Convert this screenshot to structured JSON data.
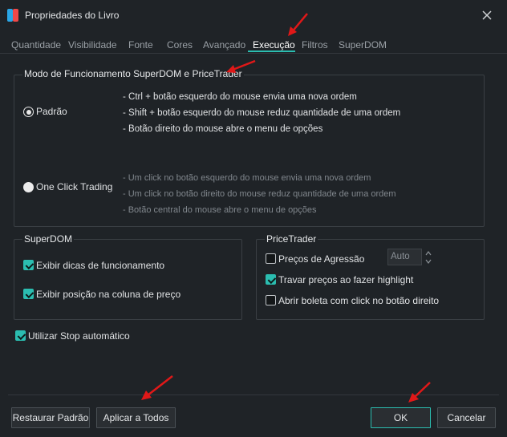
{
  "window": {
    "title": "Propriedades do Livro",
    "app_icon": "app-logo-icon",
    "close_icon": "close-icon"
  },
  "tabs": [
    {
      "label": "Quantidade"
    },
    {
      "label": "Visibilidade"
    },
    {
      "label": "Fonte"
    },
    {
      "label": "Cores"
    },
    {
      "label": "Avançado"
    },
    {
      "label": "Execução",
      "active": true
    },
    {
      "label": "Filtros"
    },
    {
      "label": "SuperDOM"
    }
  ],
  "mode_group": {
    "title": "Modo de Funcionamento SuperDOM e PriceTrader",
    "options": [
      {
        "label": "Padrão",
        "selected": true,
        "descriptions": [
          "- Ctrl + botão esquerdo do mouse envia uma nova ordem",
          "- Shift + botão esquerdo do mouse reduz quantidade de uma ordem",
          "- Botão direito do mouse abre o menu de opções"
        ]
      },
      {
        "label": "One Click Trading",
        "selected": false,
        "descriptions": [
          "- Um click no botão esquerdo do mouse envia uma nova ordem",
          "- Um click no botão direito do mouse reduz quantidade de uma ordem",
          "- Botão central do mouse abre o menu de opções"
        ]
      }
    ]
  },
  "superdom_group": {
    "title": "SuperDOM",
    "items": [
      {
        "label": "Exibir dicas de funcionamento",
        "checked": true
      },
      {
        "label": "Exibir posição na coluna de preço",
        "checked": true
      }
    ]
  },
  "pricetrader_group": {
    "title": "PriceTrader",
    "items": [
      {
        "label": "Preços de Agressão",
        "checked": false
      },
      {
        "label": "Travar preços ao fazer highlight",
        "checked": true
      },
      {
        "label": "Abrir boleta com click no botão direito",
        "checked": false
      }
    ],
    "aggression_spinner": "Auto"
  },
  "auto_stop": {
    "label": "Utilizar Stop automático",
    "checked": true
  },
  "buttons": {
    "restore": "Restaurar Padrão",
    "apply_all": "Aplicar a Todos",
    "ok": "OK",
    "cancel": "Cancelar"
  },
  "colors": {
    "accent": "#2bbdb0",
    "annotation_arrow": "#e01818",
    "background": "#1f2327"
  }
}
